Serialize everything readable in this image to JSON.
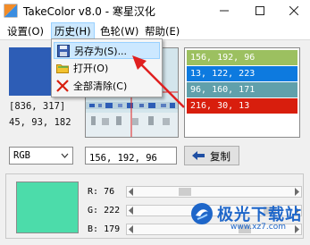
{
  "window": {
    "title": "TakeColor v8.0 - 寒星汉化",
    "controls": [
      "minimize-icon",
      "maximize-icon",
      "close-icon"
    ]
  },
  "menubar": {
    "items": [
      "设置(O)",
      "历史(H)",
      "色轮(W)",
      "帮助(E)"
    ],
    "active": "历史(H)"
  },
  "history_menu": {
    "items": [
      {
        "label": "另存为(S)...",
        "icon": "save-icon",
        "highlighted": true
      },
      {
        "label": "打开(O)",
        "icon": "folder-icon",
        "highlighted": false
      },
      {
        "label": "全部清除(C)",
        "icon": "clear-x-icon",
        "highlighted": false
      }
    ]
  },
  "picker": {
    "swatch_color": "#2d5db6",
    "coordinates": "[836, 317]",
    "rgb_text": "45, 93, 182"
  },
  "history": [
    {
      "text": "156, 192, 96",
      "color": "#9cc060"
    },
    {
      "text": "13, 122, 223",
      "color": "#0d7adf"
    },
    {
      "text": "96, 160, 171",
      "color": "#60a0ab"
    },
    {
      "text": "216, 30, 13",
      "color": "#d81e0d"
    }
  ],
  "controls": {
    "format_selected": "RGB",
    "value_field": "156, 192, 96",
    "copy_label": "复制"
  },
  "result": {
    "swatch_color": "#4cdcaa",
    "sliders": [
      {
        "label": "R:",
        "value": "76",
        "fraction": 0.298
      },
      {
        "label": "G:",
        "value": "222",
        "fraction": 0.871
      },
      {
        "label": "B:",
        "value": "179",
        "fraction": 0.702
      }
    ]
  },
  "watermark": {
    "brand": "极光下载站",
    "url": "www.xz7.com"
  },
  "colors": {
    "accent_highlight": "#cce8ff",
    "arrow_red": "#e02020",
    "watermark_blue": "#1e66c9"
  }
}
